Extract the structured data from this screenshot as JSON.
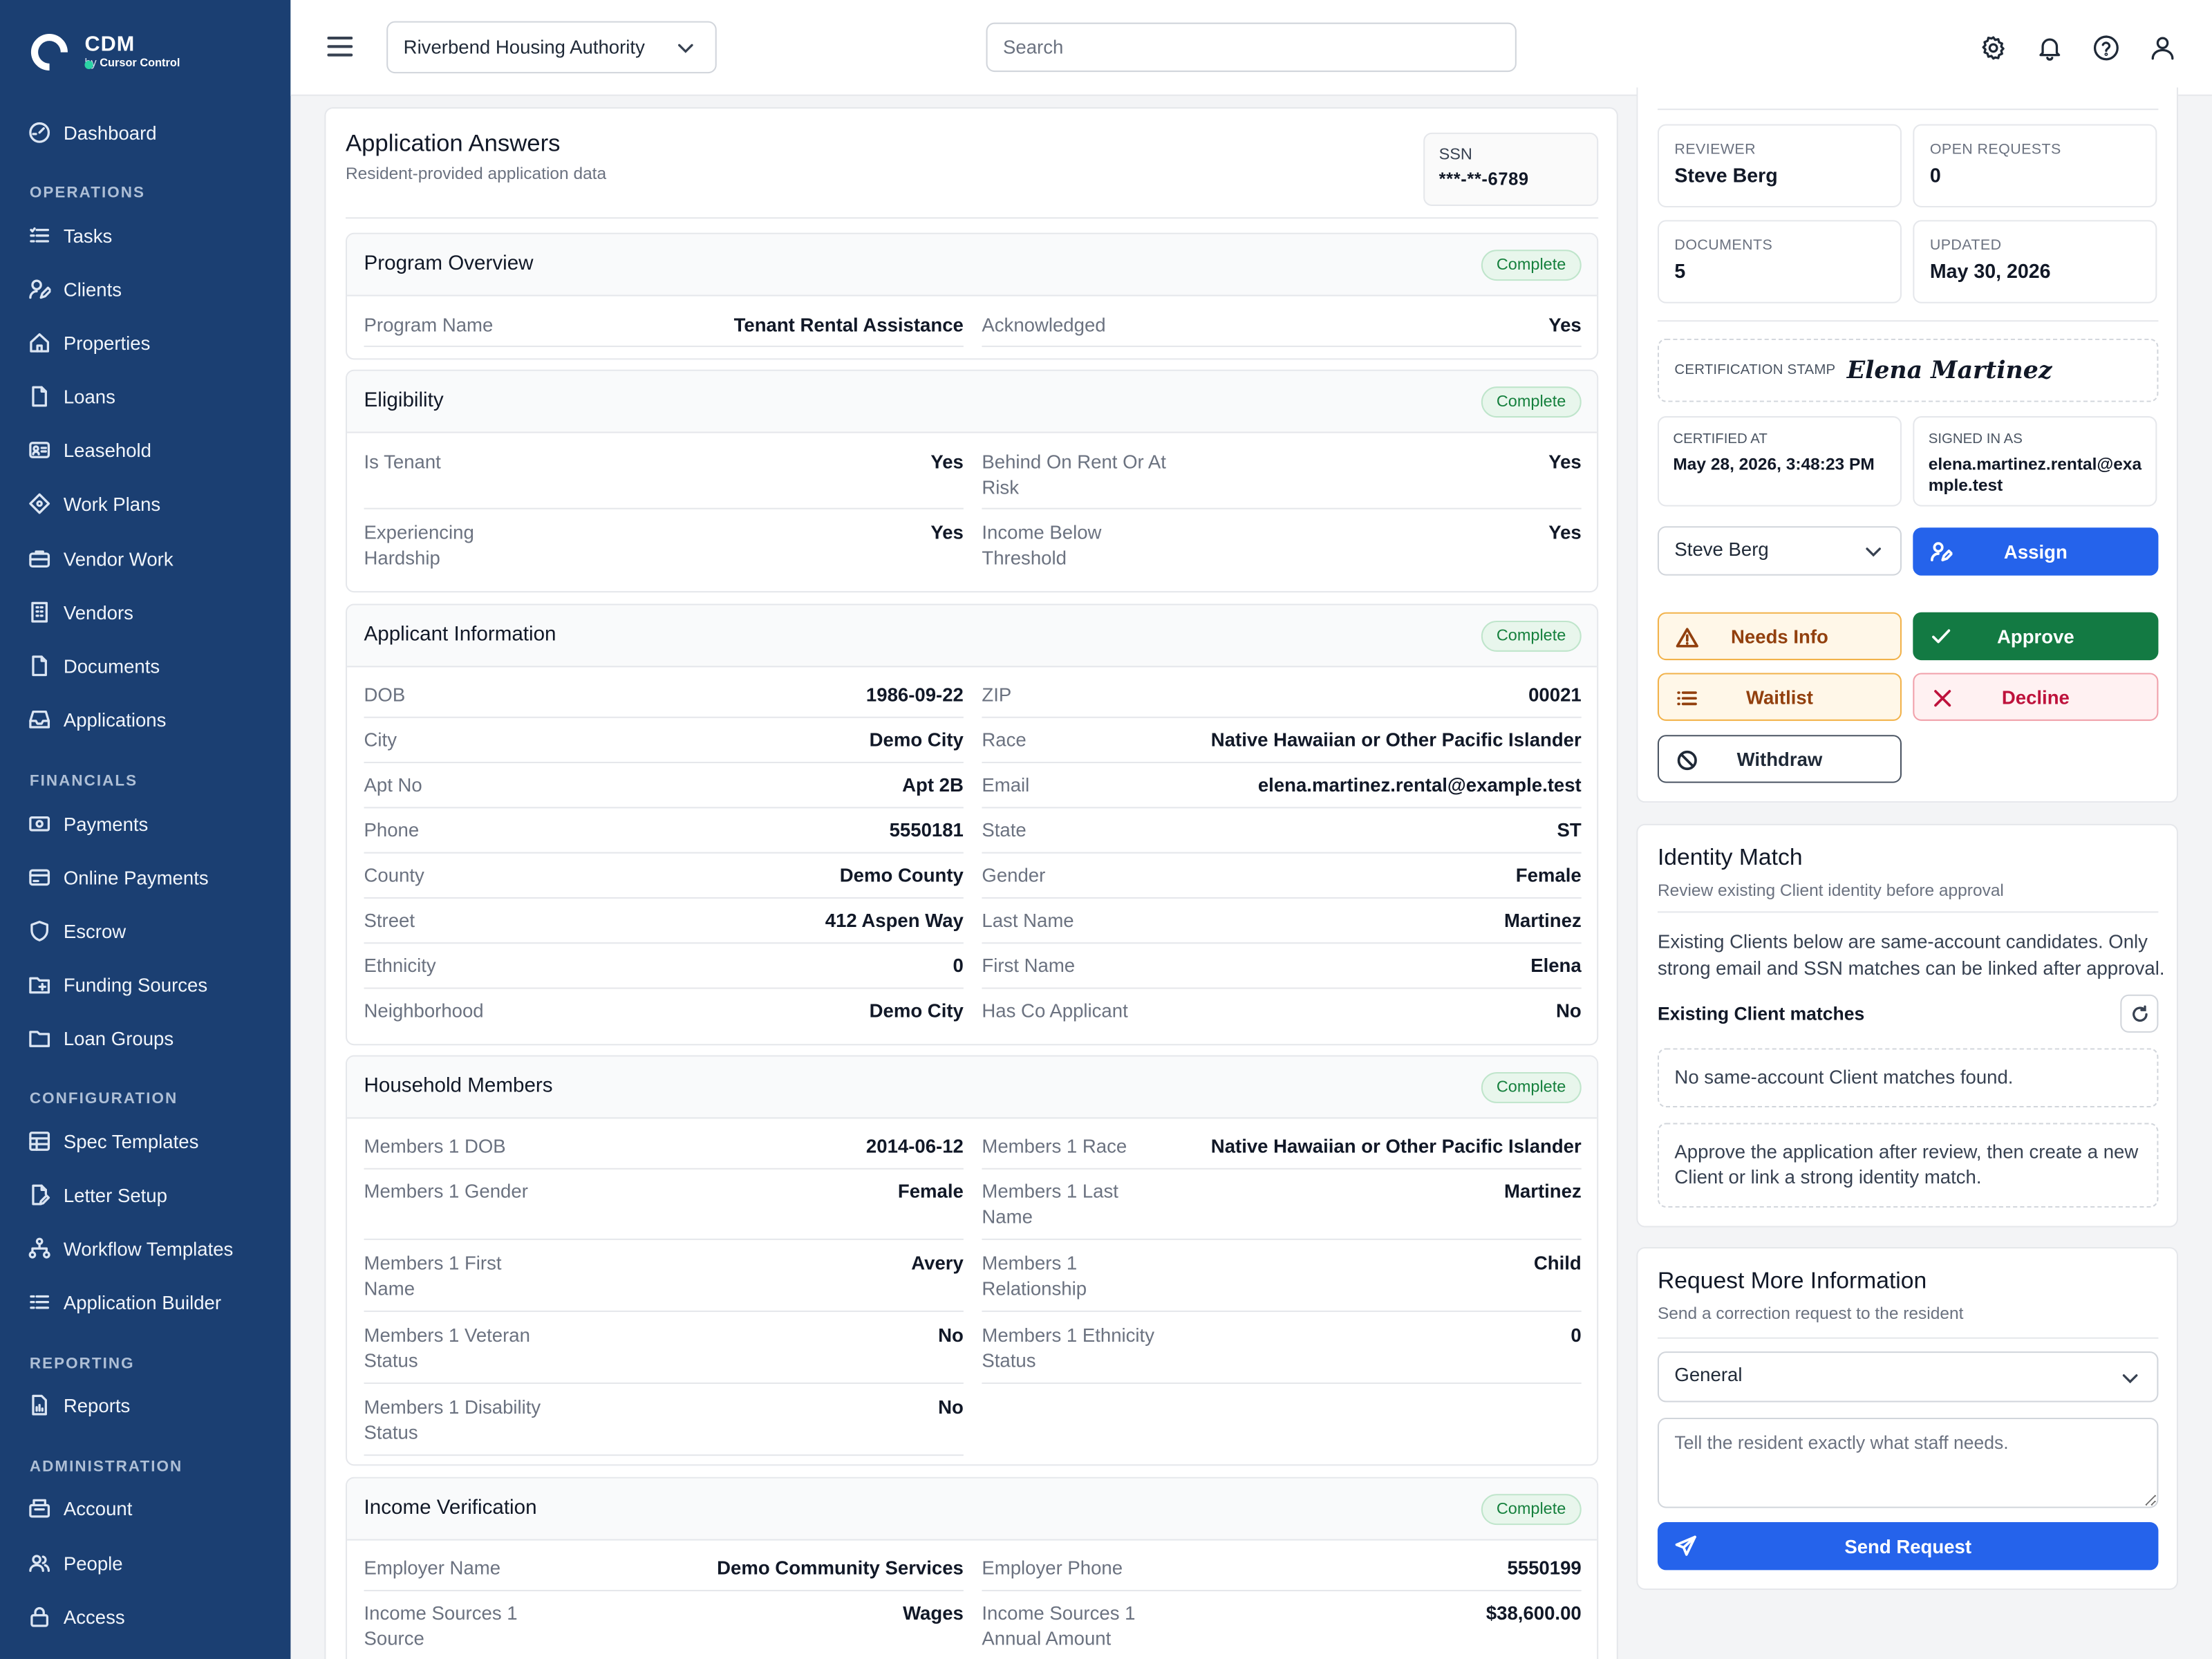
{
  "brand": {
    "name": "CDM",
    "sub_prefix": "by",
    "sub_company": "Cursor Control"
  },
  "sidebar": {
    "dashboard": "Dashboard",
    "sections": {
      "operations": "OPERATIONS",
      "financials": "FINANCIALS",
      "configuration": "CONFIGURATION",
      "reporting": "REPORTING",
      "administration": "ADMINISTRATION"
    },
    "items": {
      "tasks": "Tasks",
      "clients": "Clients",
      "properties": "Properties",
      "loans": "Loans",
      "leasehold": "Leasehold",
      "work_plans": "Work Plans",
      "vendor_work": "Vendor Work",
      "vendors": "Vendors",
      "documents": "Documents",
      "applications": "Applications",
      "payments": "Payments",
      "online_payments": "Online Payments",
      "escrow": "Escrow",
      "funding_sources": "Funding Sources",
      "loan_groups": "Loan Groups",
      "spec_templates": "Spec Templates",
      "letter_setup": "Letter Setup",
      "workflow_templates": "Workflow Templates",
      "application_builder": "Application Builder",
      "reports": "Reports",
      "account": "Account",
      "people": "People",
      "access": "Access"
    }
  },
  "topbar": {
    "org": "Riverbend Housing Authority",
    "search_placeholder": "Search",
    "icons": [
      "gear-icon",
      "bell-icon",
      "help-icon",
      "user-icon"
    ]
  },
  "application": {
    "title": "Application Answers",
    "subtitle": "Resident-provided application data",
    "ssn_label": "SSN",
    "ssn_value": "***-**-6789",
    "sections": {
      "program": {
        "title": "Program Overview",
        "status": "Complete",
        "rows": [
          {
            "k": "Program Name",
            "v": "Tenant Rental Assistance"
          },
          {
            "k": "Acknowledged",
            "v": "Yes"
          }
        ]
      },
      "eligibility": {
        "title": "Eligibility",
        "status": "Complete",
        "rows": [
          {
            "k": "Is Tenant",
            "v": "Yes"
          },
          {
            "k": "Behind On Rent Or At Risk",
            "v": "Yes"
          },
          {
            "k": "Experiencing Hardship",
            "v": "Yes"
          },
          {
            "k": "Income Below Threshold",
            "v": "Yes"
          }
        ]
      },
      "applicant": {
        "title": "Applicant Information",
        "status": "Complete",
        "rows": [
          {
            "k": "DOB",
            "v": "1986-09-22"
          },
          {
            "k": "ZIP",
            "v": "00021"
          },
          {
            "k": "City",
            "v": "Demo City"
          },
          {
            "k": "Race",
            "v": "Native Hawaiian or Other Pacific Islander"
          },
          {
            "k": "Apt No",
            "v": "Apt 2B"
          },
          {
            "k": "Email",
            "v": "elena.martinez.rental@example.test"
          },
          {
            "k": "Phone",
            "v": "5550181"
          },
          {
            "k": "State",
            "v": "ST"
          },
          {
            "k": "County",
            "v": "Demo County"
          },
          {
            "k": "Gender",
            "v": "Female"
          },
          {
            "k": "Street",
            "v": "412 Aspen Way"
          },
          {
            "k": "Last Name",
            "v": "Martinez"
          },
          {
            "k": "Ethnicity",
            "v": "0"
          },
          {
            "k": "First Name",
            "v": "Elena"
          },
          {
            "k": "Neighborhood",
            "v": "Demo City"
          },
          {
            "k": "Has Co Applicant",
            "v": "No"
          }
        ]
      },
      "household": {
        "title": "Household Members",
        "status": "Complete",
        "rows": [
          {
            "k": "Members 1 DOB",
            "v": "2014-06-12"
          },
          {
            "k": "Members 1 Race",
            "v": "Native Hawaiian or Other Pacific Islander"
          },
          {
            "k": "Members 1 Gender",
            "v": "Female"
          },
          {
            "k": "Members 1 Last Name",
            "v": "Martinez"
          },
          {
            "k": "Members 1 First Name",
            "v": "Avery"
          },
          {
            "k": "Members 1 Relationship",
            "v": "Child"
          },
          {
            "k": "Members 1 Veteran Status",
            "v": "No"
          },
          {
            "k": "Members 1 Ethnicity Status",
            "v": "0"
          },
          {
            "k": "Members 1 Disability Status",
            "v": "No"
          }
        ]
      },
      "income": {
        "title": "Income Verification",
        "status": "Complete",
        "rows": [
          {
            "k": "Employer Name",
            "v": "Demo Community Services"
          },
          {
            "k": "Employer Phone",
            "v": "5550199"
          },
          {
            "k": "Income Sources 1 Source",
            "v": "Wages"
          },
          {
            "k": "Income Sources 1 Annual Amount",
            "v": "$38,600.00"
          }
        ]
      }
    }
  },
  "review": {
    "stats": [
      {
        "label": "REVIEWER",
        "value": "Steve Berg"
      },
      {
        "label": "OPEN REQUESTS",
        "value": "0"
      },
      {
        "label": "DOCUMENTS",
        "value": "5"
      },
      {
        "label": "UPDATED",
        "value": "May 30, 2026"
      }
    ],
    "stamp_label": "CERTIFICATION STAMP",
    "stamp_signature": "Elena Martinez",
    "certified_label": "CERTIFIED AT",
    "certified_value": "May 28, 2026, 3:48:23 PM",
    "signed_label": "SIGNED IN AS",
    "signed_value": "elena.martinez.rental@example.test",
    "reviewer_select": "Steve Berg",
    "buttons": {
      "assign": "Assign",
      "needs_info": "Needs Info",
      "approve": "Approve",
      "waitlist": "Waitlist",
      "decline": "Decline",
      "withdraw": "Withdraw"
    }
  },
  "identity": {
    "title": "Identity Match",
    "subtitle": "Review existing Client identity before approval",
    "description": "Existing Clients below are same-account candidates. Only strong email and SSN matches can be linked after approval.",
    "matches_heading": "Existing Client matches",
    "no_matches": "No same-account Client matches found.",
    "hint": "Approve the application after review, then create a new Client or link a strong identity match."
  },
  "request_info": {
    "title": "Request More Information",
    "subtitle": "Send a correction request to the resident",
    "category": "General",
    "message_placeholder": "Tell the resident exactly what staff needs.",
    "send_label": "Send Request"
  },
  "colors": {
    "sidebar": "#1b3f72",
    "primary": "#2563eb",
    "approve": "#137a43",
    "complete_badge": "#15803d",
    "decline": "#be123c",
    "needs_info": "#92400e"
  }
}
